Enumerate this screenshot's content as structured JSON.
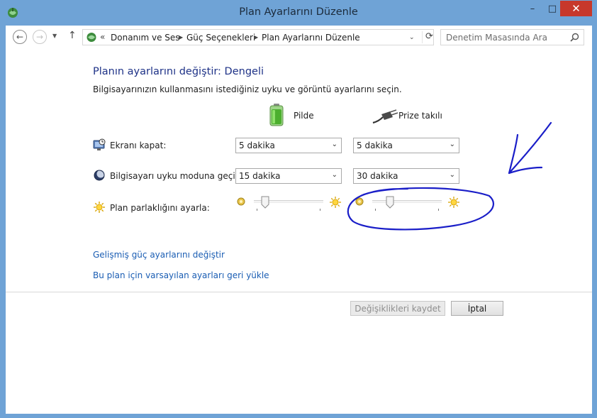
{
  "window": {
    "title": "Plan Ayarlarını Düzenle",
    "minimize": "–",
    "maximize": "□",
    "close": "✕"
  },
  "nav": {
    "back_glyph": "←",
    "forward_glyph": "→",
    "dropdown_glyph": "▼",
    "up_glyph": "↑",
    "address_prefix": "«",
    "breadcrumbs": [
      "Donanım ve Ses",
      "Güç Seçenekleri",
      "Plan Ayarlarını Düzenle"
    ],
    "refresh_glyph": "⟳",
    "search_placeholder": "Denetim Masasında Ara"
  },
  "content": {
    "heading": "Planın ayarlarını değiştir: Dengeli",
    "subtext": "Bilgisayarınızın kullanmasını istediğiniz uyku ve görüntü ayarlarını seçin.",
    "columns": {
      "battery": "Pilde",
      "plugged": "Prize takılı"
    },
    "rows": [
      {
        "label": "Ekranı kapat:",
        "battery_value": "5 dakika",
        "plugged_value": "5 dakika",
        "icon": "monitor-icon"
      },
      {
        "label": "Bilgisayarı uyku moduna geçir:",
        "battery_value": "15 dakika",
        "plugged_value": "30 dakika",
        "icon": "sleep-moon-icon"
      }
    ],
    "brightness": {
      "label": "Plan parlaklığını ayarla:",
      "battery_level": 0.12,
      "plugged_level": 0.22
    },
    "links": {
      "advanced": "Gelişmiş güç ayarlarını değiştir",
      "restore": "Bu plan için varsayılan ayarları geri yükle"
    },
    "buttons": {
      "save": "Değişiklikleri kaydet",
      "cancel": "İptal"
    }
  },
  "colors": {
    "frame": "#6fa3d6",
    "close_button": "#c7382b",
    "heading": "#1e3287",
    "link": "#1a5db3",
    "annotation_ink": "#1a1ec8"
  },
  "select_chevron": "⌄"
}
